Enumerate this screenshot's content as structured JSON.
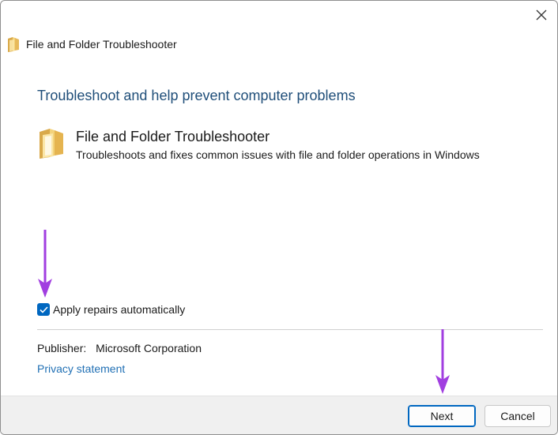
{
  "window": {
    "title": "File and Folder Troubleshooter"
  },
  "main": {
    "heading": "Troubleshoot and help prevent computer problems",
    "troubleshooter": {
      "name": "File and Folder Troubleshooter",
      "description": "Troubleshoots and fixes common issues with file and folder operations in Windows"
    },
    "apply_repairs": {
      "label": "Apply repairs automatically",
      "checked": true
    },
    "publisher": {
      "label": "Publisher:",
      "value": "Microsoft Corporation"
    },
    "privacy_link": "Privacy statement"
  },
  "footer": {
    "next_label": "Next",
    "cancel_label": "Cancel"
  },
  "icons": {
    "close": "close-icon",
    "folder": "folder-icon",
    "checkmark": "checkmark-icon",
    "annotation_arrow": "arrow-down-icon"
  },
  "colors": {
    "accent": "#0067c0",
    "heading": "#1f4e79",
    "link": "#1f6fb4",
    "annotation_arrow": "#a13ee0",
    "footer_bg": "#f0f0f0"
  }
}
